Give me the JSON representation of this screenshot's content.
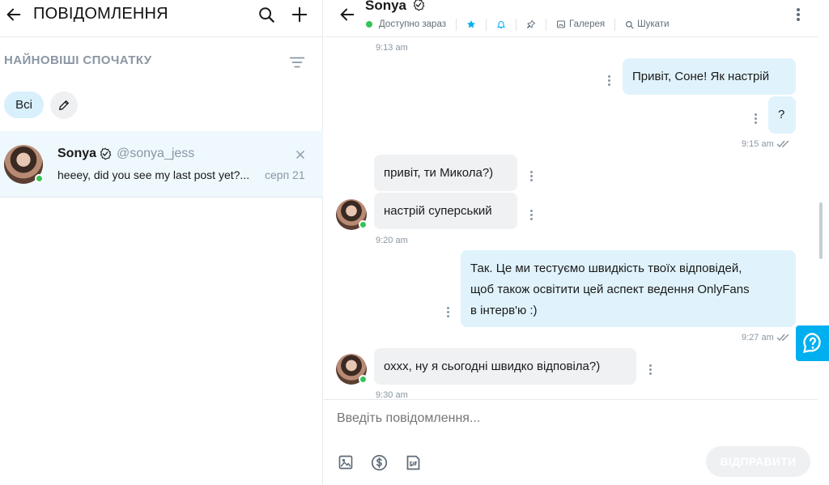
{
  "left": {
    "title": "ПОВІДОМЛЕННЯ",
    "sort_label": "НАЙНОВІШІ СПОЧАТКУ",
    "filter_all": "Всі",
    "chat": {
      "name": "Sonya",
      "handle": "@sonya_jess",
      "preview": "heeey, did you see my last post yet?...",
      "date": "серп 21"
    }
  },
  "header": {
    "name": "Sonya",
    "status": "Доступно зараз",
    "gallery": "Галерея",
    "search": "Шукати"
  },
  "messages": {
    "t1": "9:13 am",
    "m1": "Привіт, Соне! Як настрій",
    "m2": "?",
    "t2": "9:15 am",
    "m3": "привіт, ти Микола?)",
    "m4": "настрій суперський",
    "t3": "9:20 am",
    "m5_l1": "Так. Це ми тестуємо швидкість твоїх відповідей,",
    "m5_l2": "щоб також освітити цей аспект ведення OnlyFans",
    "m5_l3": "в інтерв'ю :)",
    "t4": "9:27 am",
    "m6": "оххх, ну я сьогодні швидко відповіла?)",
    "t5": "9:30 am"
  },
  "composer": {
    "placeholder": "Введіть повідомлення...",
    "send_label": "ВІДПРАВИТИ"
  },
  "colors": {
    "accent": "#00aff0",
    "online": "#35c35a",
    "bubble_out": "#e0f3fc",
    "bubble_in": "#eff1f3",
    "muted": "#8a96a3"
  }
}
